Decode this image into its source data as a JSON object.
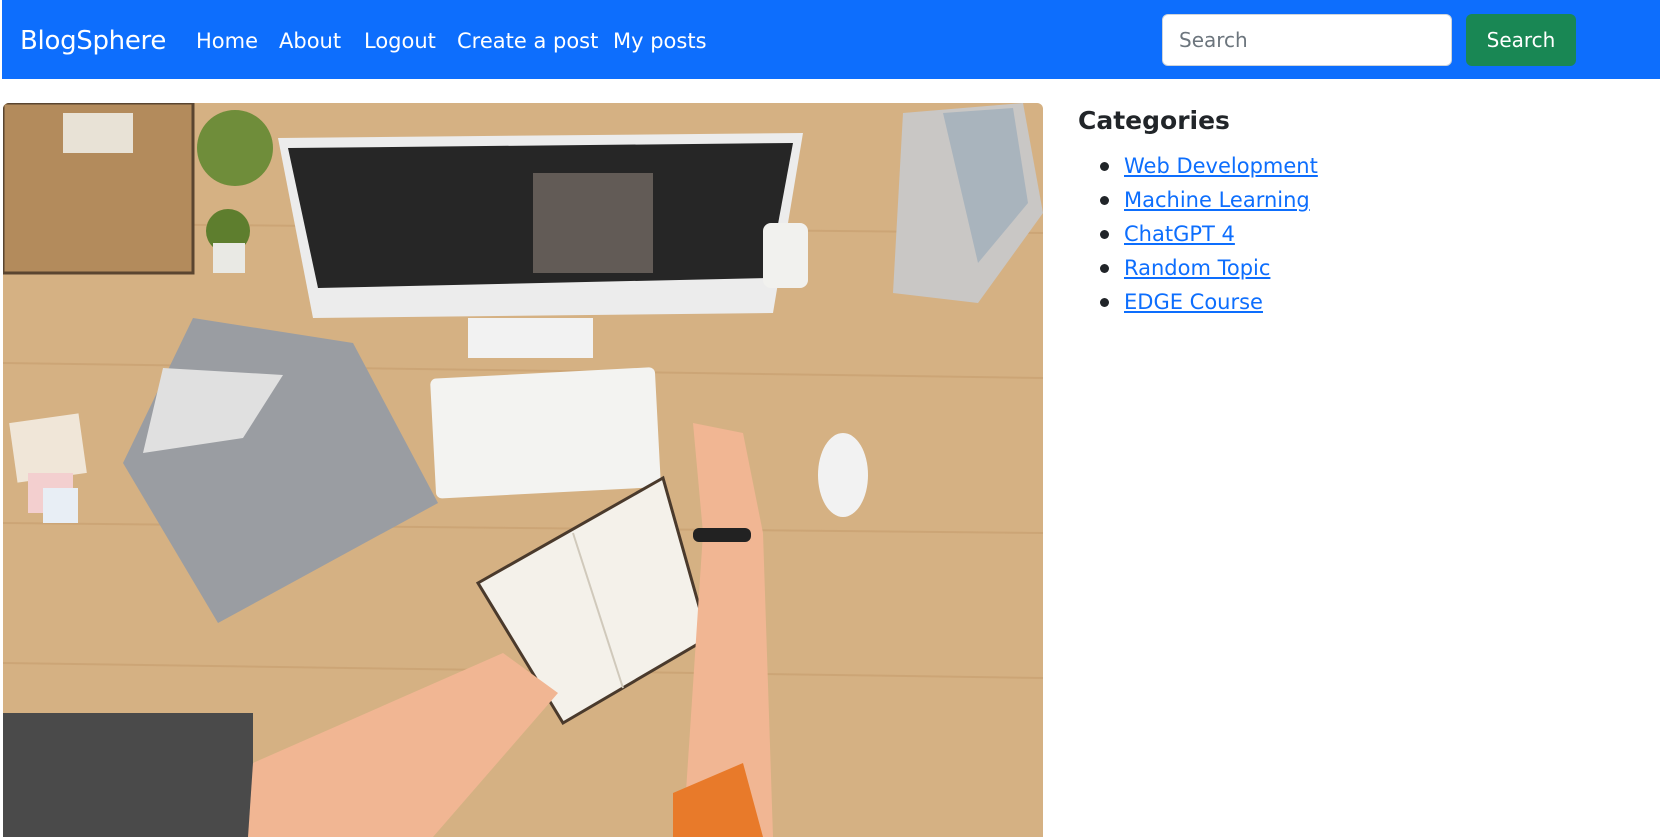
{
  "navbar": {
    "brand": "BlogSphere",
    "links": [
      "Home",
      "About",
      "Logout",
      "Create a post",
      "My posts"
    ],
    "search": {
      "placeholder": "Search",
      "value": "",
      "button_label": "Search"
    },
    "colors": {
      "background": "#0d6efd",
      "search_button": "#198754"
    }
  },
  "hero": {
    "icon": "photo-image"
  },
  "sidebar": {
    "heading": "Categories",
    "categories": [
      "Web Development",
      "Machine Learning",
      "ChatGPT 4",
      "Random Topic",
      "EDGE Course"
    ],
    "link_color": "#0d6efd"
  }
}
